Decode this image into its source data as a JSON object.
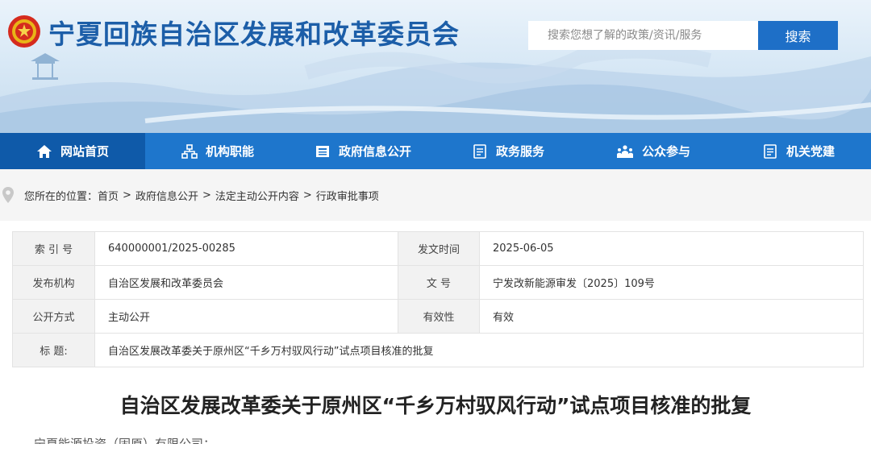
{
  "header": {
    "site_title": "宁夏回族自治区发展和改革委员会",
    "search_placeholder": "搜索您想了解的政策/资讯/服务",
    "search_button": "搜索"
  },
  "nav": {
    "items": [
      {
        "label": "网站首页",
        "icon": "home-icon",
        "active": true
      },
      {
        "label": "机构职能",
        "icon": "org-chart-icon",
        "active": false
      },
      {
        "label": "政府信息公开",
        "icon": "newspaper-icon",
        "active": false
      },
      {
        "label": "政务服务",
        "icon": "document-list-icon",
        "active": false
      },
      {
        "label": "公众参与",
        "icon": "people-icon",
        "active": false
      },
      {
        "label": "机关党建",
        "icon": "document-list-icon",
        "active": false
      }
    ]
  },
  "breadcrumb": {
    "prefix": "您所在的位置：",
    "items": [
      "首页",
      "政府信息公开",
      "法定主动公开内容",
      "行政审批事项"
    ],
    "separator": ">"
  },
  "meta": {
    "index_label": "索 引 号",
    "index_value": "640000001/2025-00285",
    "date_label": "发文时间",
    "date_value": "2025-06-05",
    "issuer_label": "发布机构",
    "issuer_value": "自治区发展和改革委员会",
    "docno_label": "文 号",
    "docno_value": "宁发改新能源审发〔2025〕109号",
    "mode_label": "公开方式",
    "mode_value": "主动公开",
    "validity_label": "有效性",
    "validity_value": "有效",
    "title_label": "标 题:",
    "title_value": "自治区发展改革委关于原州区“千乡万村驭风行动”试点项目核准的批复"
  },
  "document": {
    "title": "自治区发展改革委关于原州区“千乡万村驭风行动”试点项目核准的批复",
    "first_line": "宁夏能源投资（固原）有限公司："
  },
  "colors": {
    "brand_blue": "#1c5ea8",
    "nav_blue": "#1e76cc",
    "nav_active": "#0f5aa9",
    "button_blue": "#1e6fc7"
  }
}
